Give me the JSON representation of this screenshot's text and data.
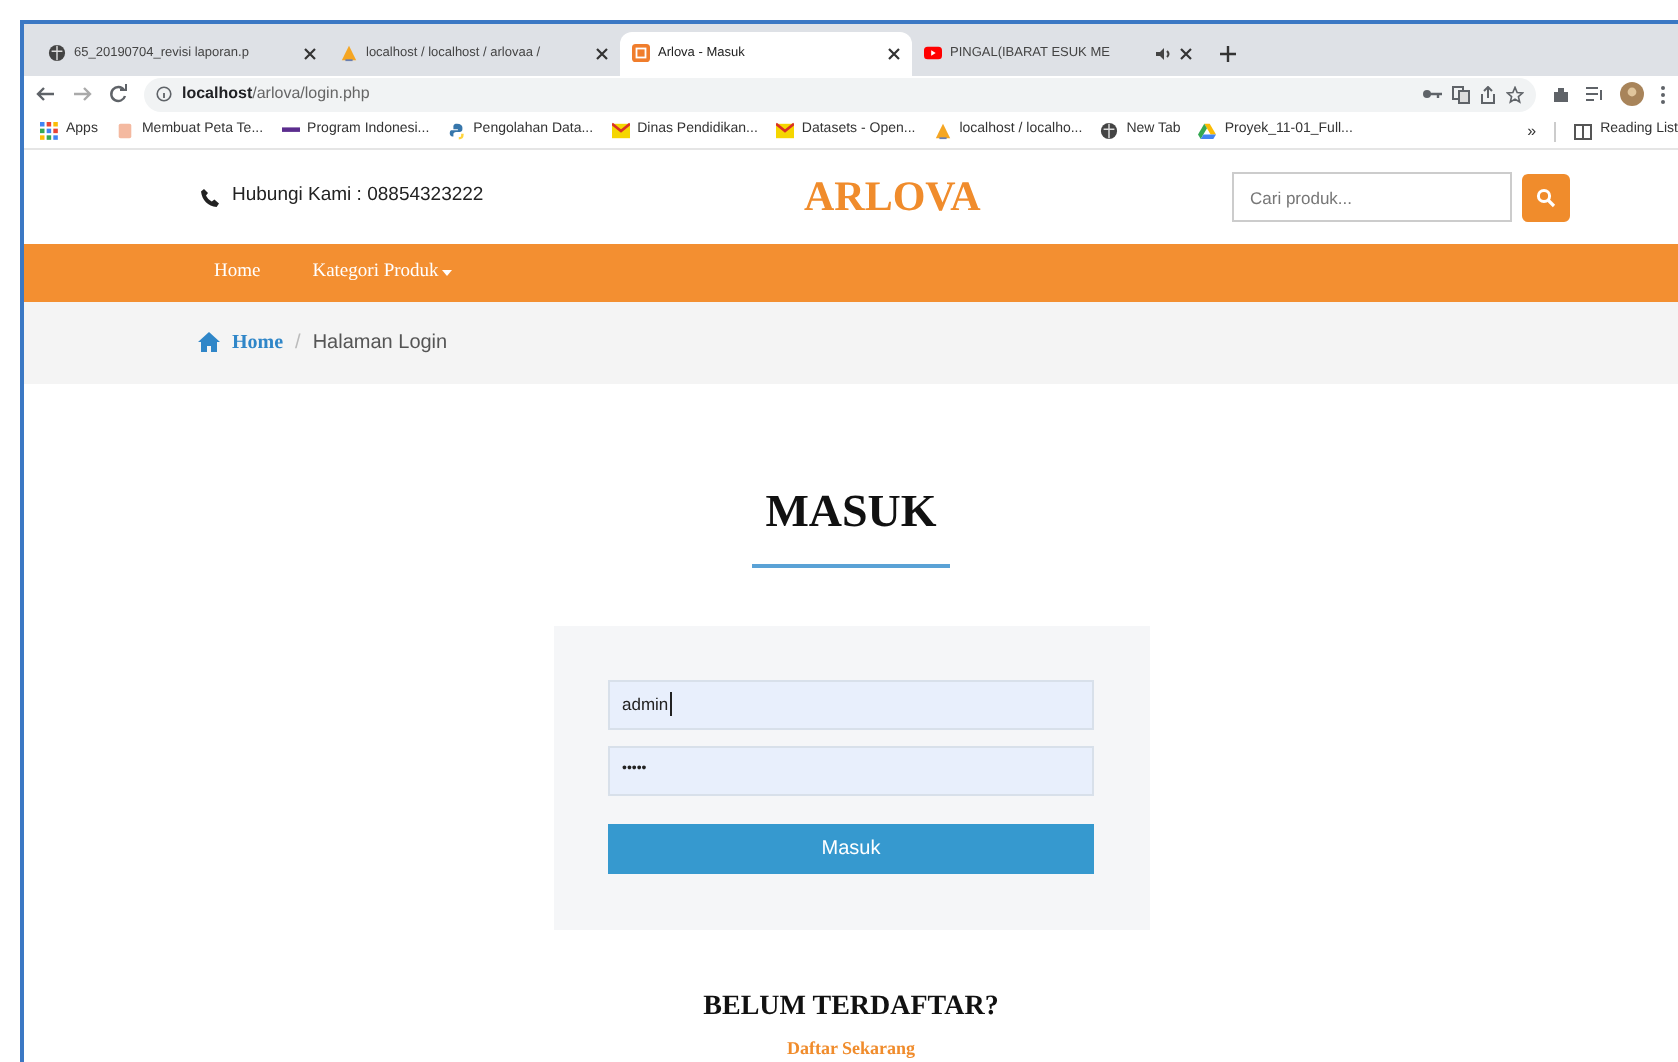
{
  "browser": {
    "tabs": [
      {
        "title": "65_20190704_revisi laporan.p",
        "selected": false,
        "audio": false
      },
      {
        "title": "localhost / localhost / arlovaa /",
        "selected": false,
        "audio": false
      },
      {
        "title": "Arlova - Masuk",
        "selected": true,
        "audio": false
      },
      {
        "title": "PINGAL(IBARAT ESUK ME",
        "selected": false,
        "audio": true
      }
    ],
    "url_host": "localhost",
    "url_path": "/arlova/login.php",
    "bookmarks": [
      "Apps",
      "Membuat Peta Te...",
      "Program Indonesi...",
      "Pengolahan Data...",
      "Dinas Pendidikan...",
      "Datasets - Open...",
      "localhost / localho...",
      "New Tab",
      "Proyek_11-01_Full..."
    ],
    "more": "»",
    "reading_list": "Reading List"
  },
  "header": {
    "contact": "Hubungi Kami : 08854323222",
    "logo": "ARLOVA",
    "search_placeholder": "Cari produk..."
  },
  "nav": [
    {
      "label": "Home",
      "dropdown": false
    },
    {
      "label": "Kategori Produk",
      "dropdown": true
    }
  ],
  "breadcrumb": [
    {
      "label": "Home",
      "link": true
    },
    {
      "label": "Halaman Login",
      "link": false
    }
  ],
  "breadcrumb_separator": "/",
  "login": {
    "title": "MASUK",
    "username": "admin",
    "password": "•••••",
    "button": "Masuk"
  },
  "register": {
    "title": "BELUM TERDAFTAR?",
    "link": "Daftar Sekarang"
  }
}
